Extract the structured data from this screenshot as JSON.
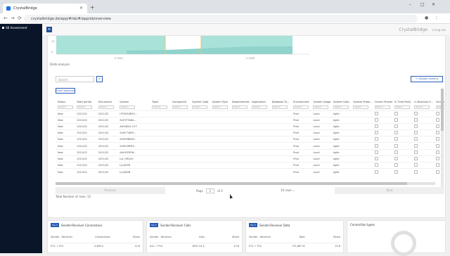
{
  "browser": {
    "tab_title": "CrystalBridge",
    "url": "crystalbridge.de/app/#/sb/#/app/sb/overview",
    "window_controls": [
      "–",
      "□",
      "✕"
    ]
  },
  "sidebar": {
    "items": [
      {
        "label": "SB Assessment"
      }
    ]
  },
  "header": {
    "brand": "CrystalBridge",
    "logout": "⏻ Log out"
  },
  "chart": {
    "tick_labels": [
      "0",
      "10",
      "0 0001",
      "0 0009"
    ],
    "colors": {
      "bar": "#a8e2d8",
      "line": "#7fc7c0",
      "accent": "#f2c35b"
    }
  },
  "section": {
    "label": "Delta analysis"
  },
  "search": {
    "placeholder": "Search"
  },
  "buttons": {
    "choose_columns": "+ Choose columns",
    "clear_selection": "Clear selection"
  },
  "table": {
    "headers": [
      "Status",
      "Start period",
      "End period",
      "System",
      "Rank",
      "Component",
      "System Code",
      "System Type",
      "Dependencies",
      "Application",
      "Database Ty...",
      "Environment",
      "System Usage",
      "System Oper...",
      "System Produ...",
      "Cluster Shared",
      "In Third Party",
      "In Business S...",
      "Carve-in Ass...",
      "System"
    ],
    "filter_label": "Select...",
    "rows": [
      [
        "New",
        "2021/02",
        "2021/02",
        "HTDGS9B30...",
        "",
        "",
        "",
        "",
        "",
        "",
        "",
        "Prod",
        "Local",
        "Agile",
        "",
        "",
        "",
        "",
        "",
        "B_FPC"
      ],
      [
        "New",
        "2021/02",
        "2021/02",
        "S4H7F948A...",
        "",
        "",
        "",
        "",
        "",
        "",
        "",
        "Prod",
        "Local",
        "Agile",
        "",
        "",
        "",
        "",
        "",
        "B_FPC"
      ],
      [
        "New",
        "2021/02",
        "2021/02",
        "AH3QB2L.H77",
        "",
        "",
        "",
        "",
        "",
        "",
        "",
        "Prod",
        "Local",
        "Agile",
        "",
        "",
        "",
        "",
        "",
        "B_FPC"
      ],
      [
        "New",
        "2021/02",
        "2021/02",
        "S4HF7V8FK...",
        "",
        "",
        "",
        "",
        "",
        "",
        "",
        "Prod",
        "Local",
        "Agile",
        "",
        "",
        "",
        "",
        "",
        "B_FPC"
      ],
      [
        "New",
        "2021/02",
        "2021/02",
        "S4HF8BEN5...",
        "",
        "",
        "",
        "",
        "",
        "",
        "",
        "Prod",
        "Local",
        "Agile",
        "",
        "",
        "",
        "",
        "",
        "B_FPC"
      ],
      [
        "New",
        "2021/02",
        "2021/02",
        "S4HF4RFR0...",
        "",
        "",
        "",
        "",
        "",
        "",
        "",
        "Prod",
        "Local",
        "Agile",
        "",
        "",
        "",
        "",
        "",
        "B_FPC"
      ],
      [
        "New",
        "2021/02",
        "2021/02",
        "AHHGFRYW...",
        "",
        "",
        "",
        "",
        "",
        "",
        "",
        "Prod",
        "Local",
        "Agile",
        "",
        "",
        "",
        "",
        "",
        "B_FPC"
      ],
      [
        "New",
        "2021/02",
        "2021/02",
        "LJ4_ORG40",
        "",
        "",
        "",
        "",
        "",
        "",
        "",
        "Prod",
        "Local",
        "Agile",
        "",
        "",
        "",
        "",
        "",
        "B_FPC"
      ],
      [
        "New",
        "2021/02",
        "2021/02",
        "LJ1QEZB",
        "",
        "",
        "",
        "",
        "",
        "",
        "",
        "Prod",
        "Local",
        "Agile",
        "",
        "",
        "",
        "",
        "",
        "B_FPC"
      ],
      [
        "New",
        "2021/02",
        "2021/02",
        "LJ1QB0B",
        "",
        "",
        "",
        "",
        "",
        "",
        "",
        "Prod",
        "Local",
        "Agile",
        "",
        "",
        "",
        "",
        "",
        "B_FPC"
      ]
    ]
  },
  "pager": {
    "prev": "Previous",
    "next": "Next",
    "page_label": "Page",
    "page_value": "1",
    "of": "of 2",
    "rows_per_page": "10 rows"
  },
  "total_rows": "Total Number of rows: 12",
  "cards": [
    {
      "tag": "Top 5",
      "title": "Sender-Receiver Connections",
      "cols": [
        "Sender - Receiver",
        "Connections",
        "Share"
      ],
      "row": [
        "P12 → P12",
        "9,894 k",
        "13.8"
      ]
    },
    {
      "tag": "Top 5",
      "title": "Sender-Receiver Calls",
      "cols": [
        "Sender - Receiver",
        "Calls",
        "Share"
      ],
      "row": [
        "A12 → P12",
        "1897.24 k",
        "13.8"
      ]
    },
    {
      "tag": "Top 5",
      "title": "Sender-Receiver Data",
      "cols": [
        "Sender - Receiver",
        "Total",
        "Share"
      ],
      "row": [
        "P12 → P12",
        "774,867 M",
        "15.8"
      ]
    },
    {
      "tag": "",
      "title": "Connection types",
      "cols": [],
      "row": []
    }
  ]
}
